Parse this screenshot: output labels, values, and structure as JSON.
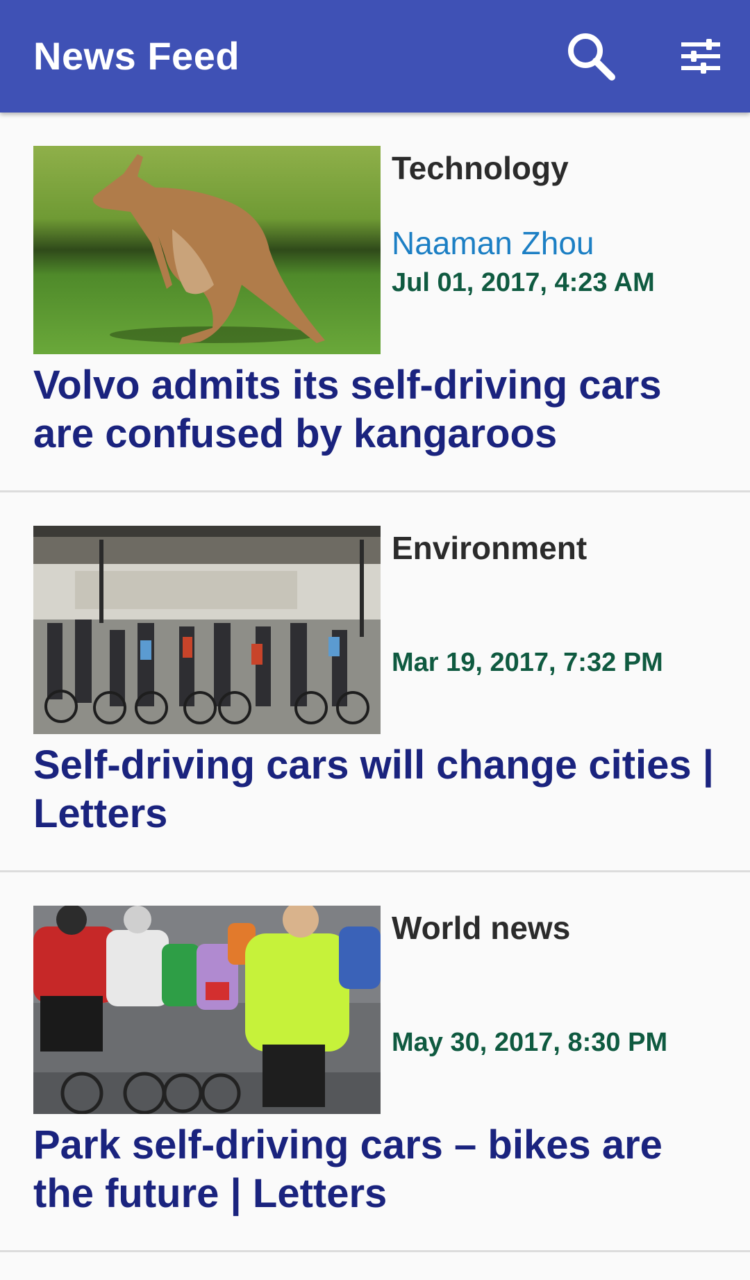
{
  "app_bar": {
    "title": "News Feed",
    "background": "#3f51b5",
    "actions": [
      {
        "icon": "search-icon"
      },
      {
        "icon": "filter-settings-icon"
      }
    ]
  },
  "articles": [
    {
      "section": "Technology",
      "author": "Naaman Zhou",
      "date": "Jul 01, 2017, 4:23 AM",
      "headline": "Volvo admits its self-driving cars are confused by kangaroos",
      "thumbnail": "kangaroo-photo"
    },
    {
      "section": "Environment",
      "author": "",
      "date": "Mar 19, 2017, 7:32 PM",
      "headline": "Self-driving cars will change cities | Letters",
      "thumbnail": "city-crossing-cyclists-photo"
    },
    {
      "section": "World news",
      "author": "",
      "date": "May 30, 2017, 8:30 PM",
      "headline": "Park self-driving cars – bikes are the future | Letters",
      "thumbnail": "cyclists-race-photo"
    }
  ],
  "colors": {
    "section_text": "#2b2b2b",
    "author_text": "#1c7fc4",
    "date_text": "#0f5a40",
    "headline_text": "#1a237e",
    "divider": "#dcdcdc"
  }
}
